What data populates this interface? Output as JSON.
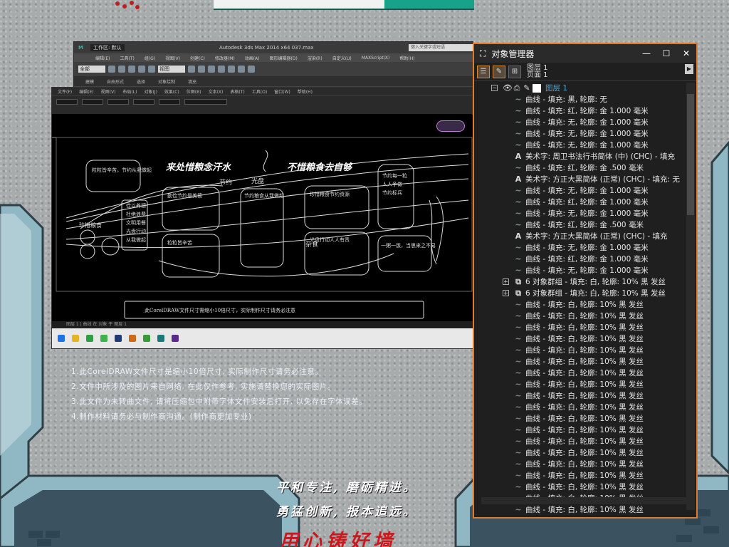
{
  "max_window": {
    "title": "Autodesk 3ds Max  2014 x64     037.max",
    "workspace": "工作区: 默认",
    "search_placeholder": "键入关键字或短语",
    "menus": [
      "编辑(E)",
      "工具(T)",
      "组(G)",
      "视图(V)",
      "创建(C)",
      "修改器(M)",
      "动画(A)",
      "图形编辑器(D)",
      "渲染(R)",
      "自定义(U)",
      "MAXScript(X)",
      "帮助(H)"
    ],
    "ribbon_tabs": [
      "建模",
      "自由形式",
      "选择",
      "对象绘制",
      "填充"
    ],
    "selection_filter": "全部",
    "view_dropdown": "视图"
  },
  "corel_window": {
    "menus": [
      "文件(F)",
      "编辑(E)",
      "视图(V)",
      "布局(L)",
      "对象(J)",
      "效果(C)",
      "位图(B)",
      "文本(X)",
      "表格(T)",
      "工具(O)",
      "窗口(W)",
      "帮助(H)"
    ],
    "statusbar": "图层 1 | 曲线 在 对象 于 图层 1",
    "design": {
      "title_left": "来处惜粮念汗水",
      "title_right": "不惜粮食去自够",
      "badge_top": "节约",
      "badge_bottom": "杂食",
      "left_box": "粒粒皆辛苦，节约从我做起",
      "left_vertical": "珍惜粮食",
      "left_panel": [
        "俭以养德",
        "杜绝浪费",
        "文明用餐",
        "光盘行动",
        "从我做起"
      ],
      "right_panel": [
        "节约每一粒",
        "人人争做",
        "节约标兵"
      ],
      "right_box": "一粥一饭，当思来之不易",
      "center_label": "光盘",
      "mid_left": "勤俭节约是美德",
      "center_heading": "节约粮食从我做起",
      "mid_right": "珍惜粮食节约资源",
      "low_left": "粒粒皆辛苦",
      "low_right": "光盘行动人人有责",
      "footer": "此CorelDRAW文件尺寸需缩小10倍尺寸，实际制作尺寸请务必注意"
    }
  },
  "notes": [
    "1.此CorelDRAW文件尺寸是缩小10倍尺寸, 实际制作尺寸请务必注意。",
    "2.文件中所涉及的图片来自网络, 在此仅作参考, 实施请替换您的实际图片。",
    "3.此文件为未转曲文件, 请将压缩包中附带字体文件安装后打开, 以免存在字体误差。",
    "4.制作材料请务必与制作商沟通。(制作商更加专业)"
  ],
  "object_manager": {
    "title": "对象管理器",
    "layer_info_top": "图层 1",
    "layer_info_page": "页面 1",
    "layer_name": "图层 1",
    "rows": [
      {
        "icon": "curve",
        "text": "曲线 - 填充: 黑, 轮廓: 无"
      },
      {
        "icon": "curve",
        "text": "曲线 - 填充: 红, 轮廓: 金 1.000 毫米"
      },
      {
        "icon": "curve",
        "text": "曲线 - 填充: 无, 轮廓: 金 1.000 毫米"
      },
      {
        "icon": "curve",
        "text": "曲线 - 填充: 无, 轮廓: 金 1.000 毫米"
      },
      {
        "icon": "curve",
        "text": "曲线 - 填充: 无, 轮廓: 金 1.000 毫米"
      },
      {
        "icon": "text",
        "text": "美术字: 周卫书法行书简体 (中) (CHC) - 填充"
      },
      {
        "icon": "curve",
        "text": "曲线 - 填充: 红, 轮廓: 金 .500 毫米"
      },
      {
        "icon": "text",
        "text": "美术字: 方正大黑简体 (正常) (CHC) - 填充: 无"
      },
      {
        "icon": "curve",
        "text": "曲线 - 填充: 无, 轮廓: 金 1.000 毫米"
      },
      {
        "icon": "curve",
        "text": "曲线 - 填充: 红, 轮廓: 金 1.000 毫米"
      },
      {
        "icon": "curve",
        "text": "曲线 - 填充: 无, 轮廓: 金 1.000 毫米"
      },
      {
        "icon": "curve",
        "text": "曲线 - 填充: 红, 轮廓: 金 .500 毫米"
      },
      {
        "icon": "text",
        "text": "美术字: 方正大黑简体 (正常) (CHC) - 填充"
      },
      {
        "icon": "curve",
        "text": "曲线 - 填充: 无, 轮廓: 金 1.000 毫米"
      },
      {
        "icon": "curve",
        "text": "曲线 - 填充: 红, 轮廓: 金 1.000 毫米"
      },
      {
        "icon": "curve",
        "text": "曲线 - 填充: 无, 轮廓: 金 1.000 毫米"
      },
      {
        "icon": "group",
        "text": "6 对象群组 - 填充: 白, 轮廓: 10% 黑 发丝",
        "expander": true
      },
      {
        "icon": "group",
        "text": "6 对象群组 - 填充: 白, 轮廓: 10% 黑 发丝",
        "expander": true
      },
      {
        "icon": "curve-dim",
        "text": "曲线 - 填充: 白, 轮廓: 10% 黑 发丝"
      },
      {
        "icon": "curve-dim",
        "text": "曲线 - 填充: 白, 轮廓: 10% 黑 发丝"
      },
      {
        "icon": "curve-dim",
        "text": "曲线 - 填充: 白, 轮廓: 10% 黑 发丝"
      },
      {
        "icon": "curve-dim",
        "text": "曲线 - 填充: 白, 轮廓: 10% 黑 发丝"
      },
      {
        "icon": "curve-dim",
        "text": "曲线 - 填充: 白, 轮廓: 10% 黑 发丝"
      },
      {
        "icon": "curve-dim",
        "text": "曲线 - 填充: 白, 轮廓: 10% 黑 发丝"
      },
      {
        "icon": "curve-dim",
        "text": "曲线 - 填充: 白, 轮廓: 10% 黑 发丝"
      },
      {
        "icon": "curve-dim",
        "text": "曲线 - 填充: 白, 轮廓: 10% 黑 发丝"
      },
      {
        "icon": "curve-dim",
        "text": "曲线 - 填充: 白, 轮廓: 10% 黑 发丝"
      },
      {
        "icon": "curve-dim",
        "text": "曲线 - 填充: 白, 轮廓: 10% 黑 发丝"
      },
      {
        "icon": "curve-dim",
        "text": "曲线 - 填充: 白, 轮廓: 10% 黑 发丝"
      },
      {
        "icon": "curve-dim",
        "text": "曲线 - 填充: 白, 轮廓: 10% 黑 发丝"
      },
      {
        "icon": "curve-dim",
        "text": "曲线 - 填充: 白, 轮廓: 10% 黑 发丝"
      },
      {
        "icon": "curve-dim",
        "text": "曲线 - 填充: 白, 轮廓: 10% 黑 发丝"
      },
      {
        "icon": "curve-dim",
        "text": "曲线 - 填充: 白, 轮廓: 10% 黑 发丝"
      },
      {
        "icon": "curve-dim",
        "text": "曲线 - 填充: 白, 轮廓: 10% 黑 发丝"
      },
      {
        "icon": "curve-dim",
        "text": "曲线 - 填充: 白, 轮廓: 10% 黑 发丝"
      },
      {
        "icon": "curve-dim",
        "text": "曲线 - 填充: 白, 轮廓: 10% 黑 发丝"
      },
      {
        "icon": "curve-dim",
        "text": "曲线 - 填充: 白, 轮廓: 10% 黑 发丝"
      }
    ]
  },
  "slogan": [
    "平和专注, 磨砺精进。",
    "勇猛创新, 报本追远。"
  ],
  "bottom_red": "用心铸好墙",
  "colors": {
    "frame_teal": "#8fb7c4",
    "accent_orange": "#e07a2d",
    "curve_blue": "#4fa3d6",
    "slogan_red": "#c8191f"
  }
}
